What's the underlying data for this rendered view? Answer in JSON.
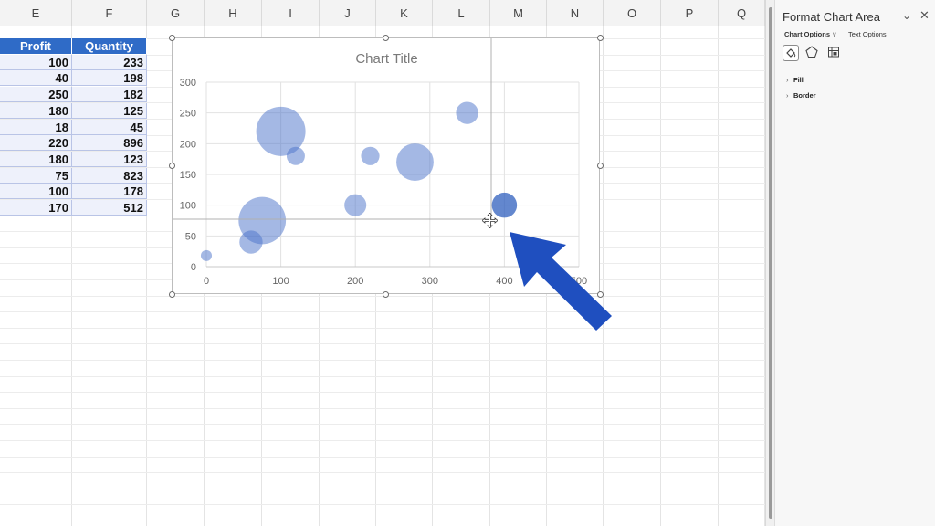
{
  "sheet": {
    "columns": [
      "E",
      "F",
      "G",
      "H",
      "I",
      "J",
      "K",
      "L",
      "M",
      "N",
      "O",
      "P",
      "Q"
    ],
    "table": {
      "headers": [
        "Profit",
        "Quantity"
      ],
      "rows": [
        [
          "100",
          "233"
        ],
        [
          "40",
          "198"
        ],
        [
          "250",
          "182"
        ],
        [
          "180",
          "125"
        ],
        [
          "18",
          "45"
        ],
        [
          "220",
          "896"
        ],
        [
          "180",
          "123"
        ],
        [
          "75",
          "823"
        ],
        [
          "100",
          "178"
        ],
        [
          "170",
          "512"
        ]
      ]
    }
  },
  "chart": {
    "title": "Chart Title",
    "bubble_color": "#4a72c9",
    "highlight_color": "#2f5fbd",
    "arrow_color": "#1f4fbf"
  },
  "chart_data": {
    "type": "scatter",
    "title": "Chart Title",
    "xlim": [
      0,
      500
    ],
    "ylim": [
      0,
      300
    ],
    "x_ticks": [
      "0",
      "100",
      "200",
      "300",
      "400",
      "500"
    ],
    "y_ticks": [
      "0",
      "50",
      "100",
      "150",
      "200",
      "250",
      "300"
    ],
    "grid": true,
    "series": [
      {
        "points": [
          {
            "x": 0,
            "y": 18,
            "size": 45
          },
          {
            "x": 60,
            "y": 40,
            "size": 198
          },
          {
            "x": 75,
            "y": 75,
            "size": 823
          },
          {
            "x": 100,
            "y": 220,
            "size": 896
          },
          {
            "x": 120,
            "y": 180,
            "size": 123
          },
          {
            "x": 200,
            "y": 100,
            "size": 178
          },
          {
            "x": 220,
            "y": 180,
            "size": 125
          },
          {
            "x": 280,
            "y": 170,
            "size": 512
          },
          {
            "x": 350,
            "y": 250,
            "size": 182
          },
          {
            "x": 400,
            "y": 100,
            "size": 233
          }
        ]
      }
    ]
  },
  "pane": {
    "title": "Format Chart Area",
    "tabs": [
      "Chart Options",
      "Text Options"
    ],
    "sections": [
      "Fill",
      "Border"
    ],
    "icons": [
      "fill-line-icon",
      "effects-icon",
      "size-properties-icon"
    ]
  }
}
